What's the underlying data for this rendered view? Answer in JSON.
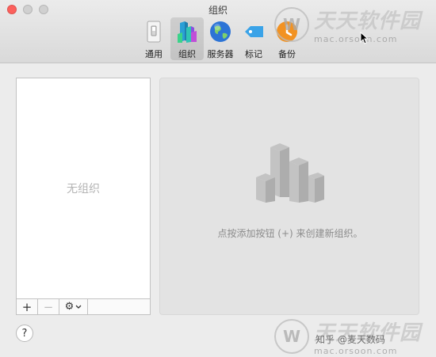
{
  "window": {
    "title": "组织"
  },
  "toolbar": {
    "items": [
      {
        "label": "通用",
        "icon": "switch-icon"
      },
      {
        "label": "组织",
        "icon": "blocks-icon",
        "active": true
      },
      {
        "label": "服务器",
        "icon": "globe-icon"
      },
      {
        "label": "标记",
        "icon": "tag-icon"
      },
      {
        "label": "备份",
        "icon": "backup-icon"
      }
    ]
  },
  "list": {
    "empty_label": "无组织",
    "controls": {
      "add": "+",
      "remove": "−",
      "gear": "⚙"
    }
  },
  "detail": {
    "message": "点按添加按钮 (+) 来创建新组织。"
  },
  "help": {
    "label": "?"
  },
  "watermark": {
    "logo": "W",
    "brand": "天天软件园",
    "url": "mac.orsoon.com",
    "zhihu": "知乎 @麦天数码"
  },
  "colors": {
    "close": "#fc605c",
    "blocks_teal": "#2fc4b4",
    "blocks_purple": "#8a4fe0",
    "globe_blue": "#2c74d6",
    "tag_blue": "#3aa3e8",
    "backup_orange": "#f29222"
  }
}
